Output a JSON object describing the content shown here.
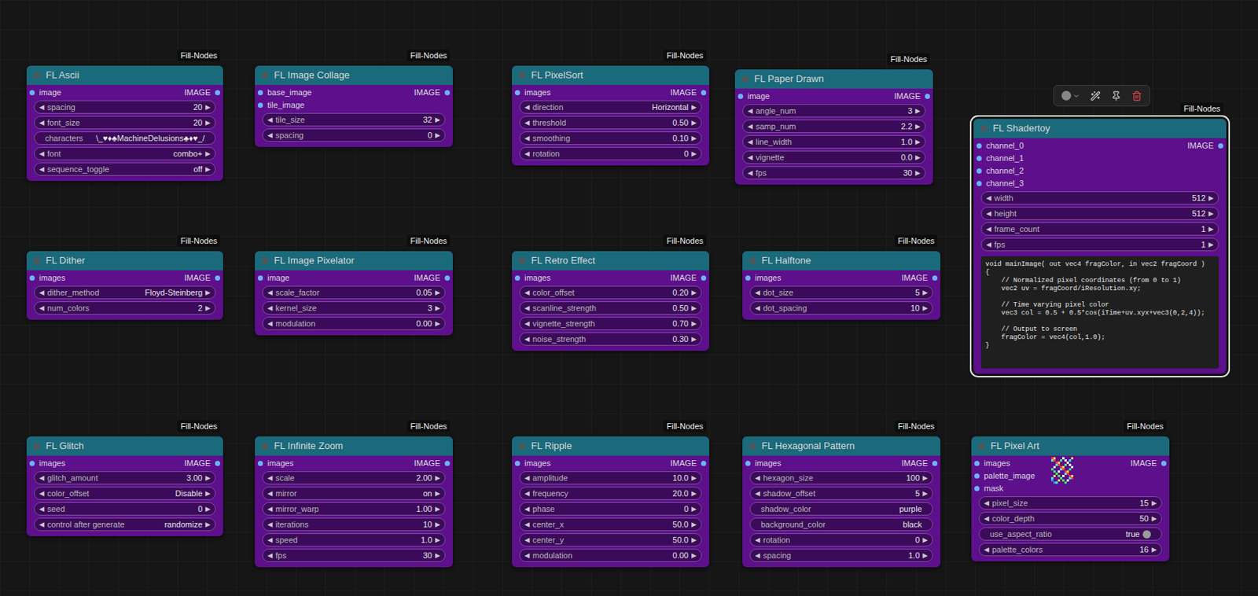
{
  "canvas": {
    "widget_arrows": {
      "left": "◀",
      "right": "▶"
    },
    "nodes": [
      {
        "title": "FL Ascii",
        "badge": "Fill-Nodes",
        "selected": false,
        "inputs": [
          "image"
        ],
        "output": "IMAGE",
        "widgets": [
          {
            "kind": "number",
            "label": "spacing",
            "value": "20"
          },
          {
            "kind": "number",
            "label": "font_size",
            "value": "20"
          },
          {
            "kind": "text",
            "label": "characters",
            "value": "\\_♥♦♣MachineDelusions♣♦♥_/"
          },
          {
            "kind": "combo",
            "label": "font",
            "value": "combo+"
          },
          {
            "kind": "combo",
            "label": "sequence_toggle",
            "value": "off"
          }
        ]
      },
      {
        "title": "FL Image Collage",
        "badge": "Fill-Nodes",
        "selected": false,
        "inputs": [
          "base_image",
          "tile_image"
        ],
        "output": "IMAGE",
        "widgets": [
          {
            "kind": "number",
            "label": "tile_size",
            "value": "32"
          },
          {
            "kind": "number",
            "label": "spacing",
            "value": "0"
          }
        ]
      },
      {
        "title": "FL PixelSort",
        "badge": "Fill-Nodes",
        "selected": false,
        "inputs": [
          "images"
        ],
        "output": "IMAGE",
        "widgets": [
          {
            "kind": "combo",
            "label": "direction",
            "value": "Horizontal"
          },
          {
            "kind": "number",
            "label": "threshold",
            "value": "0.50"
          },
          {
            "kind": "number",
            "label": "smoothing",
            "value": "0.10"
          },
          {
            "kind": "number",
            "label": "rotation",
            "value": "0"
          }
        ]
      },
      {
        "title": "FL Paper Drawn",
        "badge": "Fill-Nodes",
        "selected": false,
        "inputs": [
          "image"
        ],
        "output": "IMAGE",
        "widgets": [
          {
            "kind": "number",
            "label": "angle_num",
            "value": "3"
          },
          {
            "kind": "number",
            "label": "samp_num",
            "value": "2.2"
          },
          {
            "kind": "number",
            "label": "line_width",
            "value": "1.0"
          },
          {
            "kind": "number",
            "label": "vignette",
            "value": "0.0"
          },
          {
            "kind": "number",
            "label": "fps",
            "value": "30"
          }
        ]
      },
      {
        "title": "FL Shadertoy",
        "badge": "Fill-Nodes",
        "selected": true,
        "inputs": [
          "channel_0",
          "channel_1",
          "channel_2",
          "channel_3"
        ],
        "output": "IMAGE",
        "widgets": [
          {
            "kind": "number",
            "label": "width",
            "value": "512"
          },
          {
            "kind": "number",
            "label": "height",
            "value": "512"
          },
          {
            "kind": "number",
            "label": "frame_count",
            "value": "1"
          },
          {
            "kind": "number",
            "label": "fps",
            "value": "1"
          }
        ],
        "code": [
          "void mainImage( out vec4 fragColor, in vec2 fragCoord )",
          "{",
          "    // Normalized pixel coordinates (from 0 to 1)",
          "    vec2 uv = fragCoord/iResolution.xy;",
          "",
          "    // Time varying pixel color",
          "    vec3 col = 0.5 + 0.5*cos(iTime+uv.xyx+vec3(0,2,4));",
          "",
          "    // Output to screen",
          "    fragColor = vec4(col,1.0);",
          "}"
        ]
      },
      {
        "title": "FL Dither",
        "badge": "Fill-Nodes",
        "selected": false,
        "inputs": [
          "images"
        ],
        "output": "IMAGE",
        "widgets": [
          {
            "kind": "combo",
            "label": "dither_method",
            "value": "Floyd-Steinberg"
          },
          {
            "kind": "number",
            "label": "num_colors",
            "value": "2"
          }
        ]
      },
      {
        "title": "FL Image Pixelator",
        "badge": "Fill-Nodes",
        "selected": false,
        "inputs": [
          "image"
        ],
        "output": "IMAGE",
        "widgets": [
          {
            "kind": "number",
            "label": "scale_factor",
            "value": "0.05"
          },
          {
            "kind": "number",
            "label": "kernel_size",
            "value": "3"
          },
          {
            "kind": "number",
            "label": "modulation",
            "value": "0.00"
          }
        ]
      },
      {
        "title": "FL Retro Effect",
        "badge": "Fill-Nodes",
        "selected": false,
        "inputs": [
          "images"
        ],
        "output": "IMAGE",
        "widgets": [
          {
            "kind": "number",
            "label": "color_offset",
            "value": "0.20"
          },
          {
            "kind": "number",
            "label": "scanline_strength",
            "value": "0.50"
          },
          {
            "kind": "number",
            "label": "vignette_strength",
            "value": "0.70"
          },
          {
            "kind": "number",
            "label": "noise_strength",
            "value": "0.30"
          }
        ]
      },
      {
        "title": "FL Halftone",
        "badge": "Fill-Nodes",
        "selected": false,
        "inputs": [
          "images"
        ],
        "output": "IMAGE",
        "widgets": [
          {
            "kind": "number",
            "label": "dot_size",
            "value": "5"
          },
          {
            "kind": "number",
            "label": "dot_spacing",
            "value": "10"
          }
        ]
      },
      {
        "title": "FL Glitch",
        "badge": "Fill-Nodes",
        "selected": false,
        "inputs": [
          "images"
        ],
        "output": "IMAGE",
        "widgets": [
          {
            "kind": "number",
            "label": "glitch_amount",
            "value": "3.00"
          },
          {
            "kind": "combo",
            "label": "color_offset",
            "value": "Disable"
          },
          {
            "kind": "number",
            "label": "seed",
            "value": "0"
          },
          {
            "kind": "combo",
            "label": "control after generate",
            "value": "randomize"
          }
        ]
      },
      {
        "title": "FL Infinite Zoom",
        "badge": "Fill-Nodes",
        "selected": false,
        "inputs": [
          "images"
        ],
        "output": "IMAGE",
        "widgets": [
          {
            "kind": "number",
            "label": "scale",
            "value": "2.00"
          },
          {
            "kind": "combo",
            "label": "mirror",
            "value": "on"
          },
          {
            "kind": "number",
            "label": "mirror_warp",
            "value": "1.00"
          },
          {
            "kind": "number",
            "label": "iterations",
            "value": "10"
          },
          {
            "kind": "number",
            "label": "speed",
            "value": "1.0"
          },
          {
            "kind": "number",
            "label": "fps",
            "value": "30"
          }
        ]
      },
      {
        "title": "FL Ripple",
        "badge": "Fill-Nodes",
        "selected": false,
        "inputs": [
          "images"
        ],
        "output": "IMAGE",
        "widgets": [
          {
            "kind": "number",
            "label": "amplitude",
            "value": "10.0"
          },
          {
            "kind": "number",
            "label": "frequency",
            "value": "20.0"
          },
          {
            "kind": "number",
            "label": "phase",
            "value": "0"
          },
          {
            "kind": "number",
            "label": "center_x",
            "value": "50.0"
          },
          {
            "kind": "number",
            "label": "center_y",
            "value": "50.0"
          },
          {
            "kind": "number",
            "label": "modulation",
            "value": "0.00"
          }
        ]
      },
      {
        "title": "FL Hexagonal Pattern",
        "badge": "Fill-Nodes",
        "selected": false,
        "inputs": [
          "images"
        ],
        "output": "IMAGE",
        "widgets": [
          {
            "kind": "number",
            "label": "hexagon_size",
            "value": "100"
          },
          {
            "kind": "number",
            "label": "shadow_offset",
            "value": "5"
          },
          {
            "kind": "text",
            "label": "shadow_color",
            "value": "purple"
          },
          {
            "kind": "text",
            "label": "background_color",
            "value": "black"
          },
          {
            "kind": "number",
            "label": "rotation",
            "value": "0"
          },
          {
            "kind": "number",
            "label": "spacing",
            "value": "1.0"
          }
        ]
      },
      {
        "title": "FL Pixel Art",
        "badge": "Fill-Nodes",
        "selected": false,
        "inputs": [
          "images",
          "palette_image",
          "mask"
        ],
        "output": "IMAGE",
        "thumbnail": true,
        "widgets": [
          {
            "kind": "number",
            "label": "pixel_size",
            "value": "15"
          },
          {
            "kind": "number",
            "label": "color_depth",
            "value": "50"
          },
          {
            "kind": "toggle",
            "label": "use_aspect_ratio",
            "value": "true",
            "on": true
          },
          {
            "kind": "number",
            "label": "palette_colors",
            "value": "16"
          }
        ]
      }
    ]
  }
}
